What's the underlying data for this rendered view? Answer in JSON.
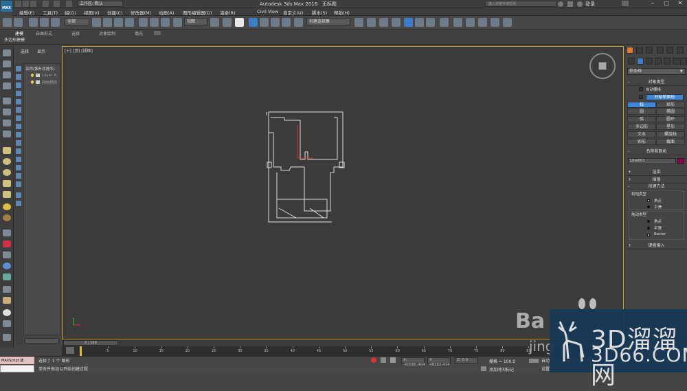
{
  "title": {
    "logo": "MAX",
    "workspace_label": "工作区: 默认",
    "app": "Autodesk 3ds Max 2016",
    "doc": "无标题",
    "search_placeholder": "键入关键字或短语",
    "login": "登录"
  },
  "menu": [
    "编辑(E)",
    "工具(T)",
    "组(G)",
    "视图(V)",
    "创建(C)",
    "修改器(M)",
    "动画(A)",
    "图形编辑器(D)",
    "渲染(R)",
    "Civil View",
    "自定义(U)",
    "脚本(S)",
    "帮助(H)"
  ],
  "toolbar": {
    "filter": "全部",
    "refsys": "视图",
    "selset": "创建选择集"
  },
  "ribbon": {
    "tabs": [
      "建模",
      "自由形式",
      "选择",
      "对象绘制",
      "填充"
    ],
    "sub": "多边形建模"
  },
  "scene": {
    "tabs": [
      "选择",
      "显示"
    ],
    "header": "名称(按升序排序)",
    "items": [
      "Layer A",
      "Line001"
    ]
  },
  "viewport": {
    "label": "[+] [顶] [线框]"
  },
  "timeline": {
    "slider": "0 / 100",
    "ticks": [
      "5",
      "10",
      "15",
      "20",
      "25",
      "30",
      "35",
      "40",
      "45",
      "50",
      "55",
      "60",
      "65",
      "70",
      "75",
      "80",
      "85"
    ]
  },
  "status": {
    "maxscript": "MAXScript 迷",
    "msg1": "选择了 1 个 图形",
    "msg2": "单击并拖动以开始创建过程",
    "x": "X: -60580.484",
    "y": "Y: 48382.414",
    "z": "Z: 0.0",
    "grid": "栅格 = 100.0",
    "addtime": "添加时间标记",
    "auto": "自动",
    "set": "设置"
  },
  "cmd": {
    "category": "样条线",
    "rollouts": {
      "objtype": "对象类型",
      "namecolor": "名称和颜色",
      "render": "渲染",
      "interp": "插值",
      "createmethod": "创建方法",
      "keyboard": "键盘输入"
    },
    "autogrid": "自动栅格",
    "startnew": "开始新图形",
    "buttons": [
      "线",
      "矩形",
      "圆",
      "椭圆",
      "弧",
      "圆环",
      "多边形",
      "星形",
      "文本",
      "螺旋线",
      "卵形",
      "截面"
    ],
    "name_value": "Line001",
    "name_color": "#8b004a",
    "initial_label": "初始类型",
    "initial_opts": [
      "角点",
      "平滑"
    ],
    "drag_label": "拖动类型",
    "drag_opts": [
      "角点",
      "平滑",
      "Bezier"
    ]
  },
  "watermark": {
    "brand1": "3D溜溜网",
    "brand2": "3D66.COM",
    "baidu1": "Ba",
    "baidu2": "jing"
  }
}
